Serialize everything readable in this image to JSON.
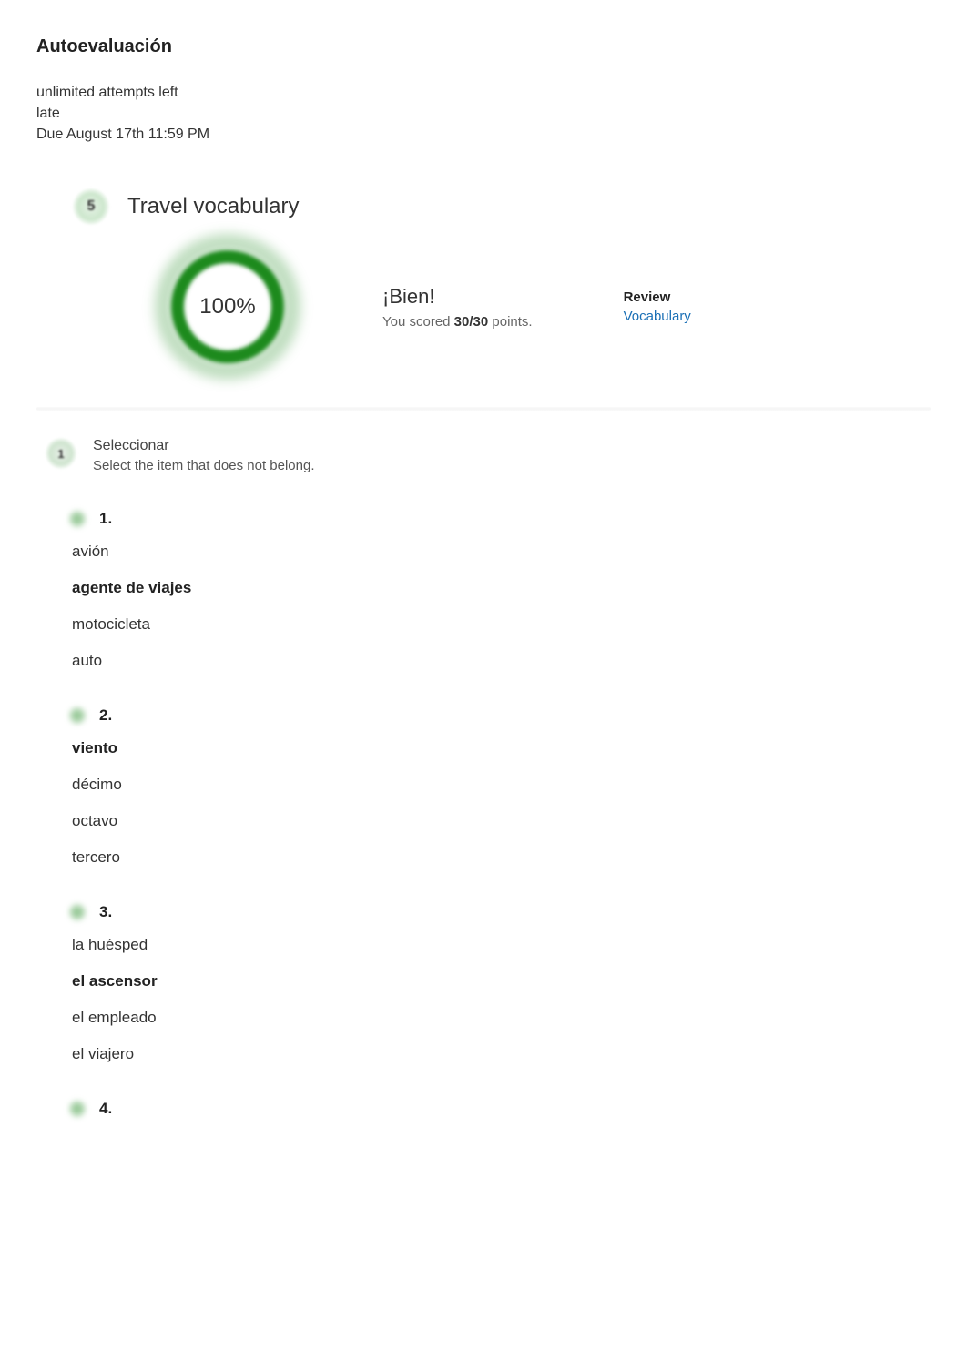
{
  "header": {
    "title": "Autoevaluación",
    "attempts": "unlimited attempts left",
    "status": "late",
    "due": "Due August 17th 11:59 PM"
  },
  "section": {
    "number": "5",
    "title": "Travel vocabulary"
  },
  "summary": {
    "score_pct": "100%",
    "result_heading": "¡Bien!",
    "scored_prefix": "You scored ",
    "scored_value": "30/30",
    "scored_suffix": " points.",
    "review_label": "Review",
    "review_link": "Vocabulary"
  },
  "question": {
    "number": "1",
    "title": "Seleccionar",
    "instructions": "Select the item that does not belong."
  },
  "items": [
    {
      "number": "1.",
      "options": [
        {
          "text": "avión",
          "answer": false
        },
        {
          "text": "agente de viajes",
          "answer": true
        },
        {
          "text": "motocicleta",
          "answer": false
        },
        {
          "text": "auto",
          "answer": false
        }
      ]
    },
    {
      "number": "2.",
      "options": [
        {
          "text": "viento",
          "answer": true
        },
        {
          "text": "décimo",
          "answer": false
        },
        {
          "text": "octavo",
          "answer": false
        },
        {
          "text": "tercero",
          "answer": false
        }
      ]
    },
    {
      "number": "3.",
      "options": [
        {
          "text": "la huésped",
          "answer": false
        },
        {
          "text": "el ascensor",
          "answer": true
        },
        {
          "text": "el empleado",
          "answer": false
        },
        {
          "text": "el viajero",
          "answer": false
        }
      ]
    },
    {
      "number": "4.",
      "options": []
    }
  ]
}
